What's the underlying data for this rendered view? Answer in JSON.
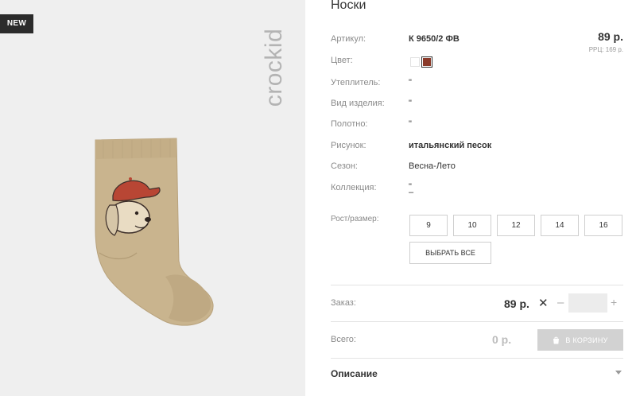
{
  "badge": {
    "new": "NEW"
  },
  "brand": {
    "logo_text": "crockid"
  },
  "product": {
    "title": "Носки",
    "price": "89 р.",
    "rrp": "РРЦ: 169 р."
  },
  "attributes": [
    {
      "label": "Артикул:",
      "value": "К 9650/2 ФВ"
    },
    {
      "label": "Цвет:",
      "value": ""
    },
    {
      "label": "Утеплитель:",
      "value": "\""
    },
    {
      "label": "Вид изделия:",
      "value": "\""
    },
    {
      "label": "Полотно:",
      "value": "\""
    },
    {
      "label": "Рисунок:",
      "value": "итальянский песок"
    },
    {
      "label": "Сезон:",
      "value": "Весна-Лето"
    },
    {
      "label": "Коллекция:",
      "value": "\"",
      "value2": "–"
    }
  ],
  "colors": [
    "#ffffff",
    "#8b3a2a"
  ],
  "sizes": {
    "label": "Рост/размер:",
    "options": [
      "9",
      "10",
      "12",
      "14",
      "16"
    ],
    "select_all": "ВЫБРАТЬ ВСЕ"
  },
  "order": {
    "label": "Заказ:",
    "price": "89 р.",
    "times": "✕",
    "minus": "–",
    "plus": "+",
    "quantity": ""
  },
  "total": {
    "label": "Всего:",
    "value": "0 р.",
    "cart_button": "В КОРЗИНУ"
  },
  "description": {
    "title": "Описание"
  }
}
